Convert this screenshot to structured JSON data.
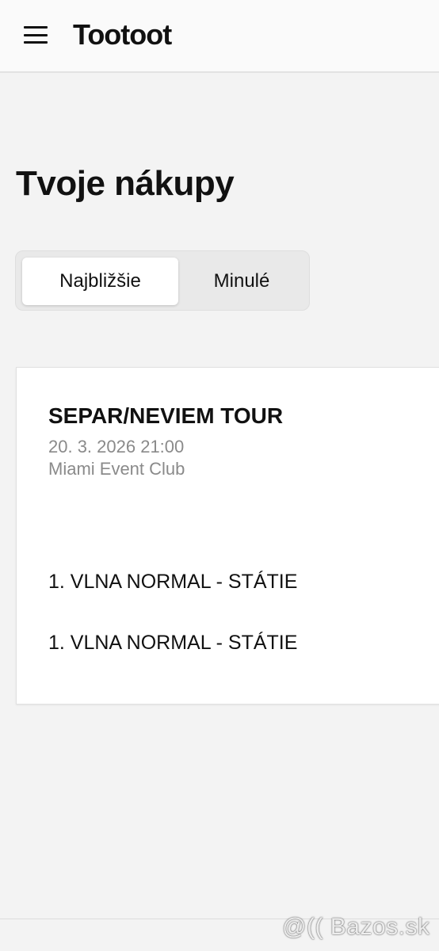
{
  "header": {
    "brand": "Tootoot",
    "menu_icon": "hamburger-menu-icon"
  },
  "page": {
    "title": "Tvoje nákupy"
  },
  "tabs": [
    {
      "label": "Najbližšie",
      "active": true
    },
    {
      "label": "Minulé",
      "active": false
    }
  ],
  "order": {
    "event_title": "SEPAR/NEVIEM TOUR",
    "date_time": "20. 3. 2026 21:00",
    "venue": "Miami Event Club",
    "tickets": [
      {
        "name": "1. VLNA NORMAL - STÁTIE"
      },
      {
        "name": "1. VLNA NORMAL - STÁTIE"
      }
    ]
  },
  "watermark": "@(( Bazos.sk"
}
